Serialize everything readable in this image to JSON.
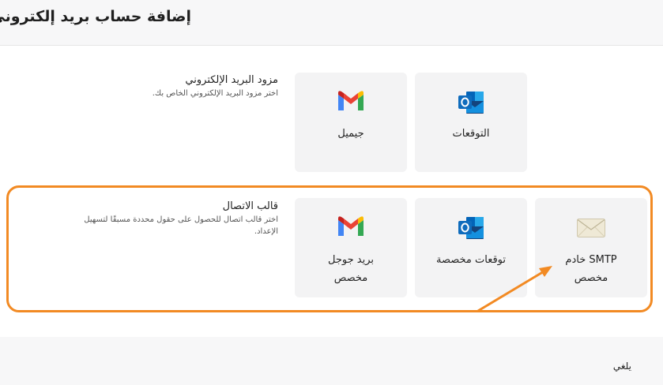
{
  "dialog": {
    "title": "إضافة حساب بريد إلكتروني"
  },
  "provider_section": {
    "title": "مزود البريد الإلكتروني",
    "description": "اختر مزود البريد الإلكتروني الخاص بك.",
    "cards": [
      {
        "label": "جيميل",
        "icon": "gmail-icon"
      },
      {
        "label": "التوقعات",
        "icon": "outlook-icon"
      }
    ]
  },
  "template_section": {
    "title": "قالب الاتصال",
    "description_line1": "اختر قالب اتصال للحصول على حقول محددة مسبقًا لتسهيل",
    "description_line2": "الإعداد.",
    "cards": [
      {
        "label_line1": "بريد جوجل",
        "label_line2": "مخصص",
        "icon": "gmail-icon"
      },
      {
        "label_line1": "توقعات مخصصة",
        "label_line2": "",
        "icon": "outlook-icon"
      },
      {
        "label_line1": "SMTP خادم",
        "label_line2": "مخصص",
        "icon": "envelope-icon"
      }
    ]
  },
  "footer": {
    "cancel_label": "يلغي"
  },
  "colors": {
    "highlight": "#f28a23",
    "card_bg": "#f3f3f4",
    "header_bg": "#f7f7f8"
  }
}
